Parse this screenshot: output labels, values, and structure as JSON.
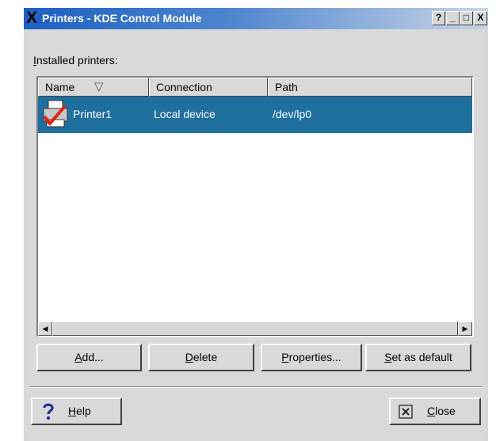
{
  "window": {
    "title": "Printers - KDE Control Module",
    "title_icon_glyph": "X",
    "controls": [
      "?",
      "_",
      "□",
      "X"
    ]
  },
  "installed_label": {
    "underline": "I",
    "rest": "nstalled printers:"
  },
  "list": {
    "columns": [
      "Name",
      "Connection",
      "Path"
    ],
    "sort_glyph": "▽",
    "rows": [
      {
        "name": "Printer1",
        "connection": "Local device",
        "path": "/dev/lp0",
        "selected": true
      }
    ]
  },
  "scrollbar": {
    "left_glyph": "◀",
    "right_glyph": "▶"
  },
  "actions": {
    "add": {
      "underline": "A",
      "rest": "dd..."
    },
    "delete": {
      "underline": "D",
      "rest": "elete"
    },
    "properties": {
      "underline": "P",
      "rest": "roperties..."
    },
    "set_default": {
      "underline": "S",
      "rest": "et as default"
    }
  },
  "footer": {
    "help": {
      "underline": "H",
      "rest": "elp"
    },
    "close": {
      "underline": "C",
      "rest": "lose"
    }
  },
  "colors": {
    "selection": "#1f6f9f",
    "titlebar_start": "#1c5fc0",
    "dialog_bg": "#d9d9d9"
  }
}
